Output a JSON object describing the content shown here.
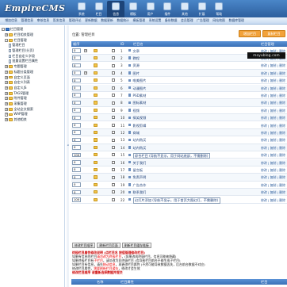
{
  "header": {
    "logo": "EmpireCMS",
    "nav": [
      "系统",
      "栏目",
      "信息",
      "模板",
      "用户",
      "插件",
      "其他",
      "扩展",
      "帮助"
    ],
    "active_nav": 2
  },
  "menubar": [
    "增加信息",
    "管理信息",
    "审核信息",
    "签发信息",
    "管理评论",
    "更新数据",
    "数据更新",
    "数据统计",
    "模板管理",
    "系统设置",
    "备份数据",
    "会员管理",
    "广告管理",
    "网站地图",
    "数据库管理"
  ],
  "tree": {
    "items": [
      {
        "label": "栏目管理",
        "depth": 0,
        "sign": "-",
        "icon": "root"
      },
      {
        "label": "栏目相关管理",
        "depth": 1,
        "sign": "+",
        "icon": "folder"
      },
      {
        "label": "栏目管理",
        "depth": 1,
        "sign": "-",
        "icon": "folder"
      },
      {
        "label": "管理栏目",
        "depth": 2,
        "sign": "",
        "icon": "doc"
      },
      {
        "label": "管理栏目(分页)",
        "depth": 2,
        "sign": "",
        "icon": "doc"
      },
      {
        "label": "栏目自定义字段",
        "depth": 2,
        "sign": "",
        "icon": "doc"
      },
      {
        "label": "批量设置栏目属性",
        "depth": 2,
        "sign": "",
        "icon": "doc"
      },
      {
        "label": "专题管理",
        "depth": 1,
        "sign": "+",
        "icon": "folder"
      },
      {
        "label": "标题分类管理",
        "depth": 1,
        "sign": "+",
        "icon": "folder"
      },
      {
        "label": "自定义页面",
        "depth": 1,
        "sign": "+",
        "icon": "folder"
      },
      {
        "label": "自定义列表",
        "depth": 1,
        "sign": "+",
        "icon": "folder"
      },
      {
        "label": "自定义JS",
        "depth": 1,
        "sign": "+",
        "icon": "folder"
      },
      {
        "label": "TAGS管理",
        "depth": 1,
        "sign": "+",
        "icon": "folder"
      },
      {
        "label": "附件管理",
        "depth": 1,
        "sign": "+",
        "icon": "folder"
      },
      {
        "label": "采集管理",
        "depth": 1,
        "sign": "+",
        "icon": "folder"
      },
      {
        "label": "全站全文搜索",
        "depth": 1,
        "sign": "+",
        "icon": "folder"
      },
      {
        "label": "WAP管理",
        "depth": 1,
        "sign": "+",
        "icon": "folder"
      },
      {
        "label": "其他相关",
        "depth": 1,
        "sign": "+",
        "icon": "folder"
      }
    ]
  },
  "main": {
    "breadcrumb": "位置: 管理栏目",
    "add_button": "增加栏目",
    "copy_button": "复制栏目",
    "watermark": "moyublog.com",
    "columns": {
      "order": "顺序",
      "id": "ID",
      "name": "栏目名",
      "ops": "栏目管理"
    },
    "rows": [
      {
        "order": "0",
        "plus": true,
        "id": "1",
        "name": "文章",
        "boxed": false,
        "ops": "修改 | 复制 | 删除"
      },
      {
        "order": "0",
        "plus": false,
        "id": "2",
        "name": "教程",
        "boxed": false,
        "ops": "修改 | 复制 | 删除"
      },
      {
        "order": "0",
        "plus": false,
        "id": "3",
        "name": "资源",
        "boxed": false,
        "ops": "修改 | 复制 | 删除"
      },
      {
        "order": "0",
        "plus": true,
        "id": "4",
        "name": "图片",
        "boxed": false,
        "ops": "修改 | 复制 | 删除"
      },
      {
        "order": "0",
        "plus": false,
        "id": "5",
        "name": "唯美图片",
        "boxed": false,
        "ops": "修改 | 复制 | 删除"
      },
      {
        "order": "0",
        "plus": false,
        "id": "6",
        "name": "动漫图片",
        "boxed": false,
        "ops": "修改 | 复制 | 删除"
      },
      {
        "order": "0",
        "plus": false,
        "id": "7",
        "name": "PSD素材",
        "boxed": false,
        "ops": "修改 | 复制 | 删除"
      },
      {
        "order": "0",
        "plus": false,
        "id": "8",
        "name": "图标素材",
        "boxed": false,
        "ops": "修改 | 复制 | 删除"
      },
      {
        "order": "0",
        "plus": false,
        "id": "9",
        "name": "视频",
        "boxed": false,
        "ops": "修改 | 复制 | 删除"
      },
      {
        "order": "0",
        "plus": false,
        "id": "10",
        "name": "搞笑视频",
        "boxed": false,
        "ops": "修改 | 复制 | 删除"
      },
      {
        "order": "0",
        "plus": false,
        "id": "11",
        "name": "影视剪辑",
        "boxed": false,
        "ops": "修改 | 复制 | 删除"
      },
      {
        "order": "0",
        "plus": false,
        "id": "12",
        "name": "商城",
        "boxed": false,
        "ops": "修改 | 复制 | 删除"
      },
      {
        "order": "0",
        "plus": false,
        "id": "13",
        "name": "站内购买",
        "boxed": false,
        "ops": "修改 | 复制 | 删除"
      },
      {
        "order": "0",
        "plus": false,
        "id": "14",
        "name": "站内购买",
        "boxed": false,
        "ops": "修改 | 复制 | 删除"
      },
      {
        "order": "100",
        "plus": false,
        "id": "15",
        "name": "综合栏目 (导航不显示，用于网站底部，不需删除)",
        "boxed": true,
        "ops": "修改 | 复制 | 删除"
      },
      {
        "order": "0",
        "plus": false,
        "id": "16",
        "name": "关于我们",
        "boxed": false,
        "ops": "修改 | 复制 | 删除"
      },
      {
        "order": "0",
        "plus": false,
        "id": "17",
        "name": "留言板",
        "boxed": false,
        "ops": "修改 | 复制 | 删除"
      },
      {
        "order": "0",
        "plus": false,
        "id": "18",
        "name": "免责声明",
        "boxed": false,
        "ops": "修改 | 复制 | 删除"
      },
      {
        "order": "0",
        "plus": false,
        "id": "19",
        "name": "广告合作",
        "boxed": false,
        "ops": "修改 | 复制 | 删除"
      },
      {
        "order": "0",
        "plus": false,
        "id": "20",
        "name": "联系我们",
        "boxed": false,
        "ops": "修改 | 复制 | 删除"
      },
      {
        "order": "100",
        "plus": false,
        "id": "22",
        "name": "幻灯片添加 (导航不显示，用于首页大图幻灯，不需删除)",
        "boxed": true,
        "ops": "修改 | 复制 | 删除"
      }
    ],
    "bottom_buttons": [
      "修改栏目顺序",
      "刷新栏目页面",
      "刷新栏目缓存链接"
    ],
    "notes": {
      "title": "终极栏目属性修改说明 (点栏目名 按值管理修改栏目)",
      "lines": [
        {
          "prefix": "如果有信息的栏目",
          "red": "请勿改为终极栏目",
          "suffix": "，(如果改成终极栏目，信息可能被隐藏)"
        },
        {
          "prefix": "如果终极栏目有",
          "red": "子栏目",
          "suffix": "，请勿改为非终极栏目 (会导致栏目前台不能生成子栏目)"
        },
        {
          "prefix": "如果栏目有信息，请先",
          "red": "移动信息",
          "suffix": "，再更改栏目属性 (不然可能导致数据丢失，后台前台数据不对应)"
        },
        {
          "prefix": "修改栏目属性，",
          "red": "需要刷新栏目缓存",
          "suffix": "，修改才会生效"
        }
      ],
      "last": "修改栏目顺序 请重新选择数据并提交"
    },
    "footer_columns": {
      "name": "名称",
      "id": "栏目属性",
      "ops": "栏目"
    }
  }
}
